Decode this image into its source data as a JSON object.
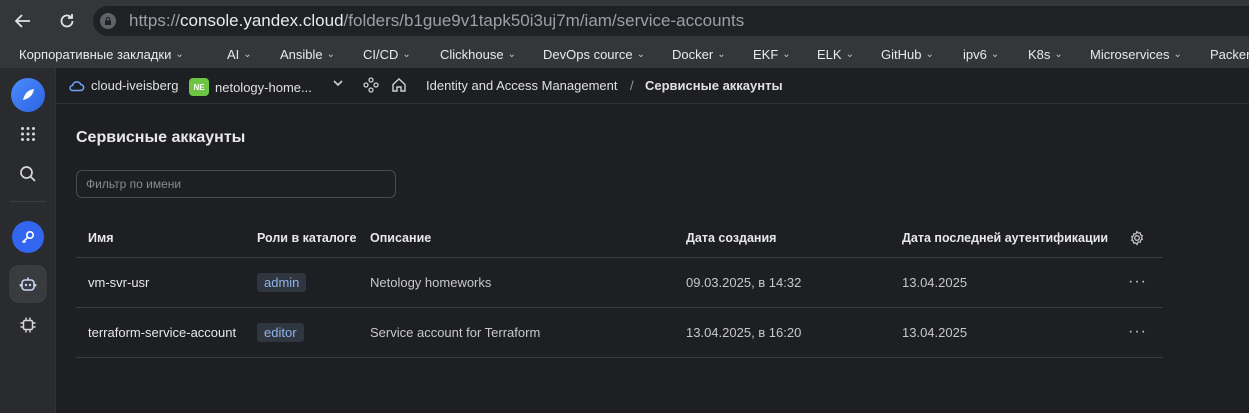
{
  "browser": {
    "url_scheme": "https://",
    "url_host": "console.yandex.cloud",
    "url_path": "/folders/b1gue9v1tapk50i3uj7m/iam/service-accounts"
  },
  "bookmarks": [
    "Корпоративные закладки",
    "AI",
    "Ansible",
    "CI/CD",
    "Clickhouse",
    "DevOps cource",
    "Docker",
    "EKF",
    "ELK",
    "GitHub",
    "ipv6",
    "K8s",
    "Microservices",
    "Packer"
  ],
  "topnav": {
    "cloud": "cloud-iveisberg",
    "folder_badge": "NE",
    "folder": "netology-home...",
    "service": "Identity and Access Management",
    "separator": "/",
    "current": "Сервисные аккаунты"
  },
  "page": {
    "title": "Сервисные аккаунты",
    "filter_placeholder": "Фильтр по имени"
  },
  "table": {
    "headers": {
      "name": "Имя",
      "roles": "Роли в каталоге",
      "description": "Описание",
      "created": "Дата создания",
      "last_auth": "Дата последней аутентификации"
    },
    "rows": [
      {
        "name": "vm-svr-usr",
        "role": "admin",
        "description": "Netology homeworks",
        "created": "09.03.2025, в 14:32",
        "last_auth": "13.04.2025",
        "more": "···"
      },
      {
        "name": "terraform-service-account",
        "role": "editor",
        "description": "Service account for Terraform",
        "created": "13.04.2025, в 16:20",
        "last_auth": "13.04.2025",
        "more": "···"
      }
    ]
  },
  "colors": {
    "background": "#1e1f22",
    "sidebar": "#2a2b2f",
    "accent": "#3366ee",
    "role_text": "#8fb3e6",
    "folder_badge": "#6cc644"
  }
}
